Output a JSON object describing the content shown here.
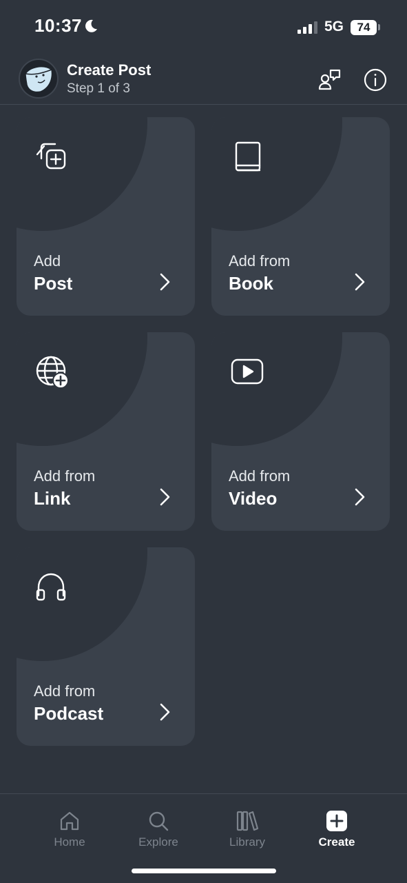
{
  "status": {
    "time": "10:37",
    "network": "5G",
    "battery": "74"
  },
  "header": {
    "title": "Create Post",
    "subtitle": "Step 1 of 3"
  },
  "cards": [
    {
      "prefix": "Add",
      "label": "Post",
      "icon": "add-post-icon"
    },
    {
      "prefix": "Add from",
      "label": "Book",
      "icon": "book-icon"
    },
    {
      "prefix": "Add from",
      "label": "Link",
      "icon": "globe-plus-icon"
    },
    {
      "prefix": "Add from",
      "label": "Video",
      "icon": "video-play-icon"
    },
    {
      "prefix": "Add from",
      "label": "Podcast",
      "icon": "headphones-icon"
    }
  ],
  "nav": [
    {
      "label": "Home",
      "icon": "home-icon"
    },
    {
      "label": "Explore",
      "icon": "search-icon"
    },
    {
      "label": "Library",
      "icon": "library-icon"
    },
    {
      "label": "Create",
      "icon": "create-plus-icon",
      "active": true
    }
  ],
  "colors": {
    "background": "#2e343d",
    "card": "#3a414b",
    "inactive": "#7d848d"
  }
}
